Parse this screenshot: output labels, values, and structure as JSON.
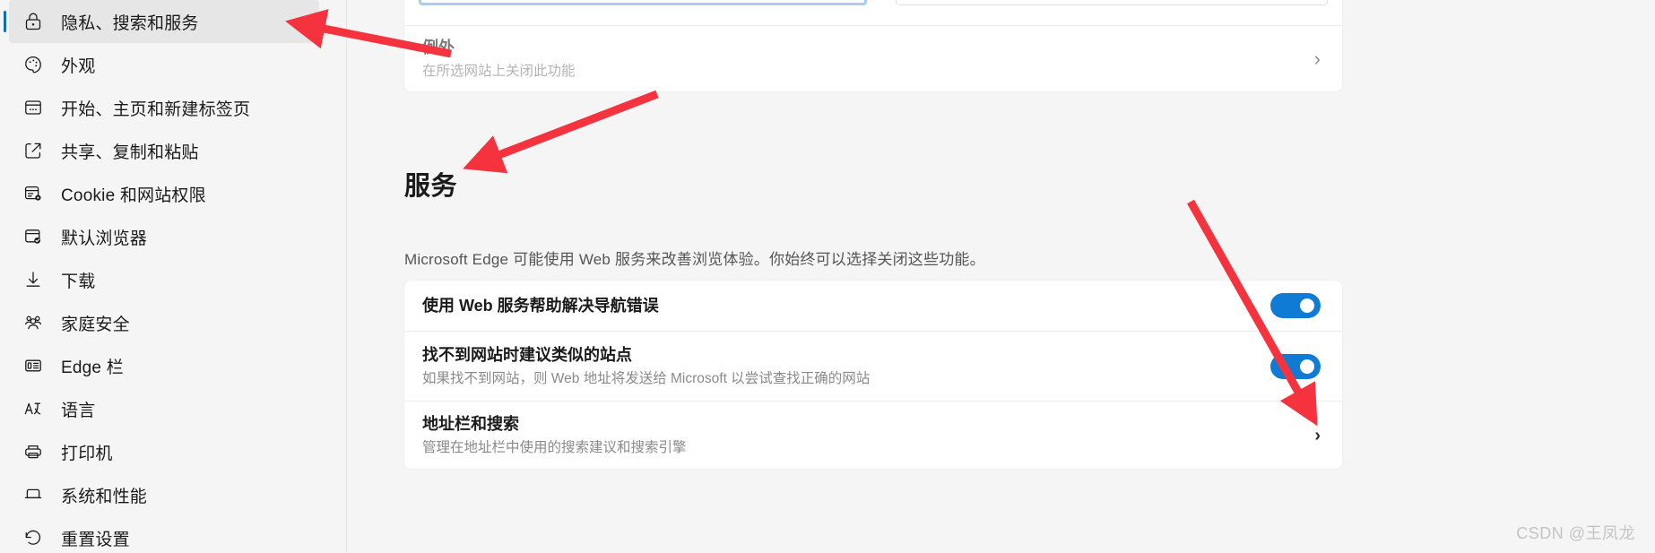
{
  "sidebar": {
    "items": [
      {
        "label": "隐私、搜索和服务",
        "icon": "lock-icon",
        "active": true
      },
      {
        "label": "外观",
        "icon": "palette-icon",
        "active": false
      },
      {
        "label": "开始、主页和新建标签页",
        "icon": "browser-start-icon",
        "active": false
      },
      {
        "label": "共享、复制和粘贴",
        "icon": "share-icon",
        "active": false
      },
      {
        "label": "Cookie 和网站权限",
        "icon": "cookie-settings-icon",
        "active": false
      },
      {
        "label": "默认浏览器",
        "icon": "default-browser-check-icon",
        "active": false
      },
      {
        "label": "下载",
        "icon": "download-arrow-icon",
        "active": false
      },
      {
        "label": "家庭安全",
        "icon": "family-people-icon",
        "active": false
      },
      {
        "label": "Edge 栏",
        "icon": "edge-bar-icon",
        "active": false
      },
      {
        "label": "语言",
        "icon": "language-icon",
        "active": false
      },
      {
        "label": "打印机",
        "icon": "printer-icon",
        "active": false
      },
      {
        "label": "系统和性能",
        "icon": "laptop-icon",
        "active": false
      },
      {
        "label": "重置设置",
        "icon": "reset-arrow-icon",
        "active": false
      }
    ]
  },
  "top_card": {
    "exception": {
      "title": "例外",
      "subtitle": "在所选网站上关闭此功能",
      "chevron": "›"
    }
  },
  "services_section": {
    "heading": "服务",
    "description": "Microsoft Edge 可能使用 Web 服务来改善浏览体验。你始终可以选择关闭这些功能。",
    "rows": [
      {
        "title": "使用 Web 服务帮助解决导航错误",
        "subtitle": "",
        "control": "toggle",
        "toggle_on": true
      },
      {
        "title": "找不到网站时建议类似的站点",
        "subtitle": "如果找不到网站，则 Web 地址将发送给 Microsoft 以尝试查找正确的网站",
        "control": "toggle",
        "toggle_on": true
      },
      {
        "title": "地址栏和搜索",
        "subtitle": "管理在地址栏中使用的搜索建议和搜索引擎",
        "control": "chevron",
        "chevron": "›"
      }
    ]
  },
  "watermark": "CSDN @王凤龙",
  "colors": {
    "toggle_on": "#0f7bd4",
    "selection_bar": "#0f6cbd",
    "annotation_arrow": "#f5333f",
    "focus_border": "#a8cdf0",
    "page_background": "#f5f5f5",
    "card_background": "#ffffff"
  }
}
